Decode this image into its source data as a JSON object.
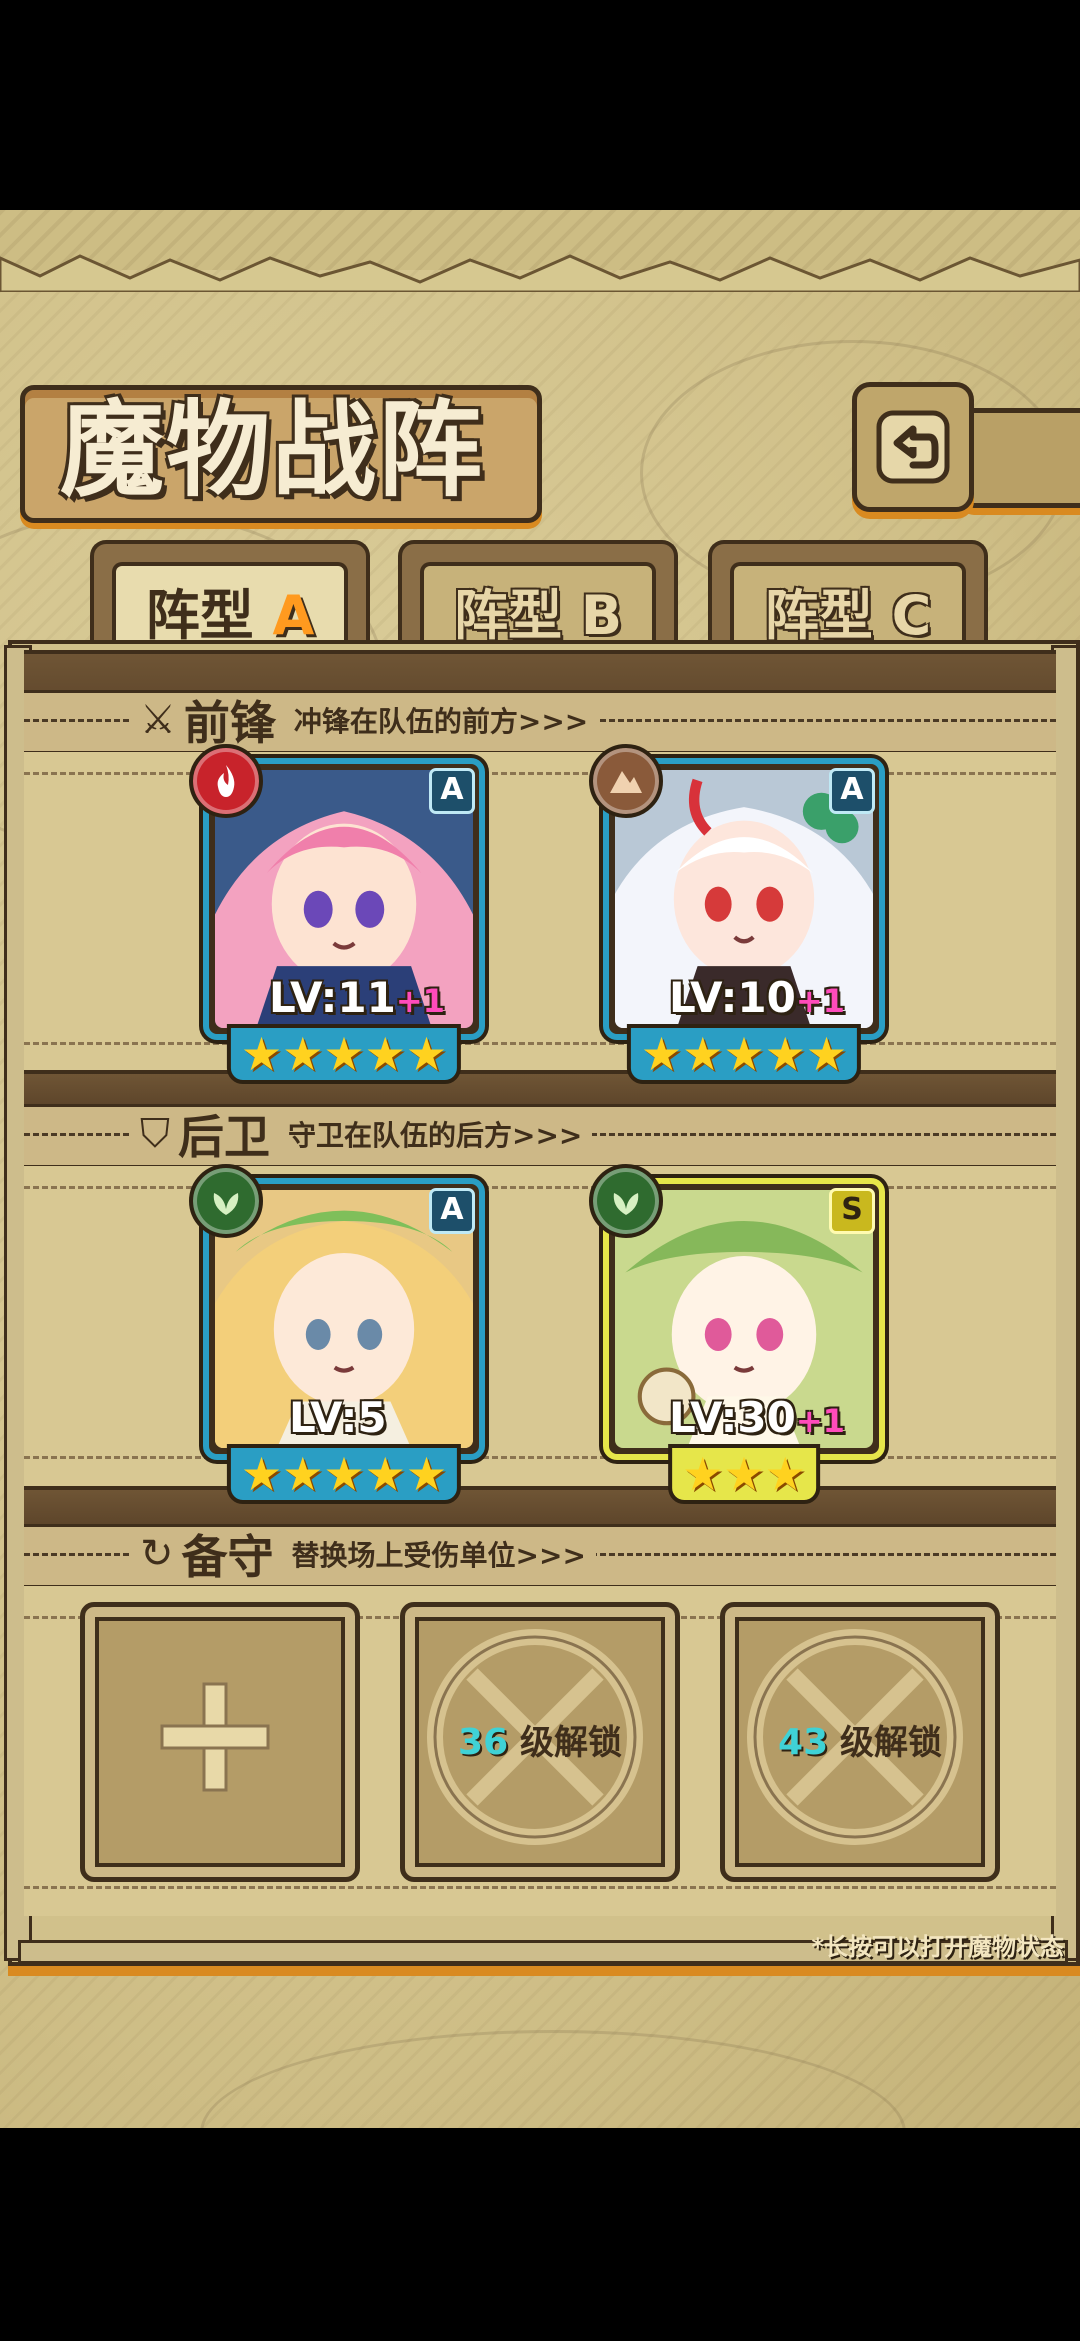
{
  "header": {
    "title": "魔物战阵"
  },
  "tabs": [
    {
      "prefix": "阵型",
      "letter": "A",
      "active": true
    },
    {
      "prefix": "阵型",
      "letter": "B",
      "active": false
    },
    {
      "prefix": "阵型",
      "letter": "C",
      "active": false
    }
  ],
  "sections": {
    "front": {
      "name": "前锋",
      "desc": "冲锋在队伍的前方>>>",
      "icon": "sword-icon"
    },
    "back": {
      "name": "后卫",
      "desc": "守卫在队伍的后方>>>",
      "icon": "shield-icon"
    },
    "reserve": {
      "name": "备守",
      "desc": "替换场上受伤单位>>>",
      "icon": "swap-icon"
    }
  },
  "front_units": [
    {
      "lv": "LV:11",
      "plus": "+1",
      "rank": "A",
      "stars": 5,
      "element": "fire",
      "element_color": "#c8232b"
    },
    {
      "lv": "LV:10",
      "plus": "+1",
      "rank": "A",
      "stars": 5,
      "element": "earth",
      "element_color": "#8a5a3a"
    }
  ],
  "back_units": [
    {
      "lv": "LV:5",
      "plus": "",
      "rank": "A",
      "stars": 5,
      "element": "nature",
      "element_color": "#2f6b2f"
    },
    {
      "lv": "LV:30",
      "plus": "+1",
      "rank": "S",
      "stars": 3,
      "element": "nature",
      "element_color": "#2f6b2f"
    }
  ],
  "reserve_slots": [
    {
      "type": "add"
    },
    {
      "type": "locked",
      "level": "36",
      "suffix": "级解锁"
    },
    {
      "type": "locked",
      "level": "43",
      "suffix": "级解锁"
    }
  ],
  "footer_hint": "*长按可以打开魔物状态",
  "colors": {
    "accent_orange": "#ff9a1f",
    "card_blue": "#2a9ec4",
    "card_gold": "#e6e64a",
    "plus_pink": "#ff4bbb",
    "unlock_cyan": "#3fd2d6"
  }
}
